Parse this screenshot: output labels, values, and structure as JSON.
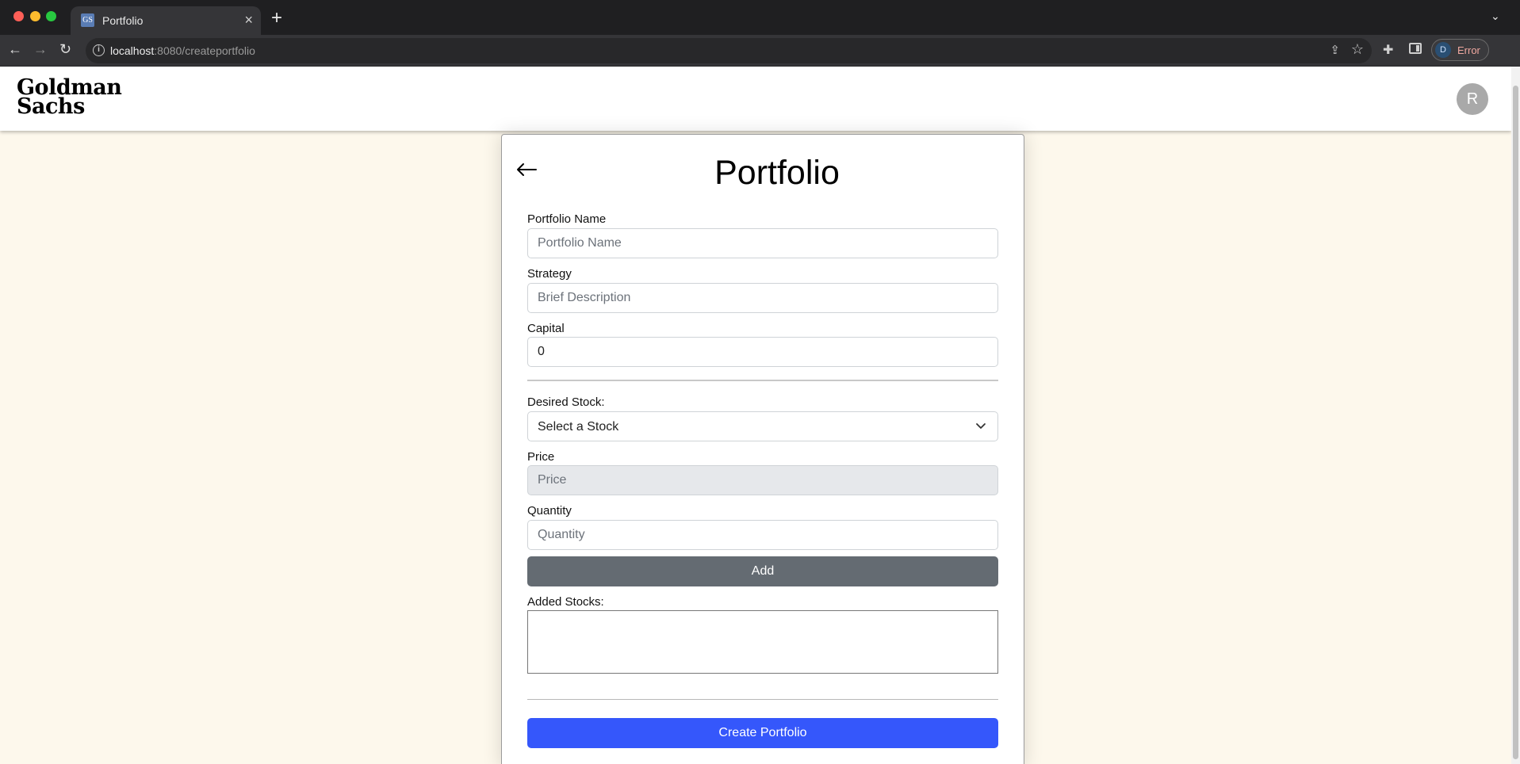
{
  "browser": {
    "tab_title": "Portfolio",
    "tab_favicon_text": "GS",
    "tab_close_glyph": "×",
    "new_tab_glyph": "+",
    "tab_menu_glyph": "⌄",
    "url_host": "localhost",
    "url_path": ":8080/createportfolio",
    "profile_initial": "D",
    "profile_label": "Error"
  },
  "header": {
    "logo_line1": "Goldman",
    "logo_line2": "Sachs",
    "user_initial": "R"
  },
  "form": {
    "title": "Portfolio",
    "portfolio_name": {
      "label": "Portfolio Name",
      "placeholder": "Portfolio Name",
      "value": ""
    },
    "strategy": {
      "label": "Strategy",
      "placeholder": "Brief Description",
      "value": ""
    },
    "capital": {
      "label": "Capital",
      "value": "0"
    },
    "desired_stock": {
      "label": "Desired Stock:",
      "selected": "Select a Stock"
    },
    "price": {
      "label": "Price",
      "placeholder": "Price",
      "value": ""
    },
    "quantity": {
      "label": "Quantity",
      "placeholder": "Quantity",
      "value": ""
    },
    "add_button": "Add",
    "added_stocks_label": "Added Stocks:",
    "create_button": "Create Portfolio"
  },
  "colors": {
    "page_bg": "#fdf8ec",
    "add_button": "#646b72",
    "create_button": "#3557fb"
  },
  "icons": [
    "back-arrow-icon",
    "chevron-down-icon",
    "reload-icon",
    "info-icon",
    "share-icon",
    "star-icon",
    "extensions-icon",
    "side-panel-icon"
  ]
}
